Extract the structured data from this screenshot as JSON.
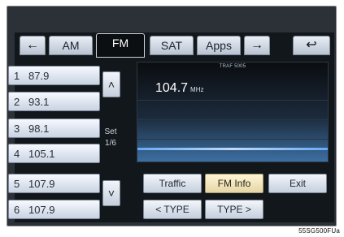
{
  "tabs": {
    "prev_icon": "left-arrow-icon",
    "am": "AM",
    "fm": "FM",
    "sat": "SAT",
    "apps": "Apps",
    "next_icon": "right-arrow-icon",
    "back_icon": "return-arrow-icon"
  },
  "presets": [
    {
      "num": "1",
      "freq": "87.9"
    },
    {
      "num": "2",
      "freq": "93.1"
    },
    {
      "num": "3",
      "freq": "98.1"
    },
    {
      "num": "4",
      "freq": "105.1"
    },
    {
      "num": "5",
      "freq": "107.9"
    },
    {
      "num": "6",
      "freq": "107.9"
    }
  ],
  "set": {
    "label": "Set",
    "page": "1/6"
  },
  "display": {
    "traffic_top": "TRAF 5005",
    "frequency": "104.7",
    "unit": "MHz"
  },
  "buttons": {
    "traffic": "Traffic",
    "fm_info": "FM Info",
    "exit": "Exit",
    "type_prev": "< TYPE",
    "type_next": "TYPE >"
  },
  "figure_code": "55SG500FUa"
}
